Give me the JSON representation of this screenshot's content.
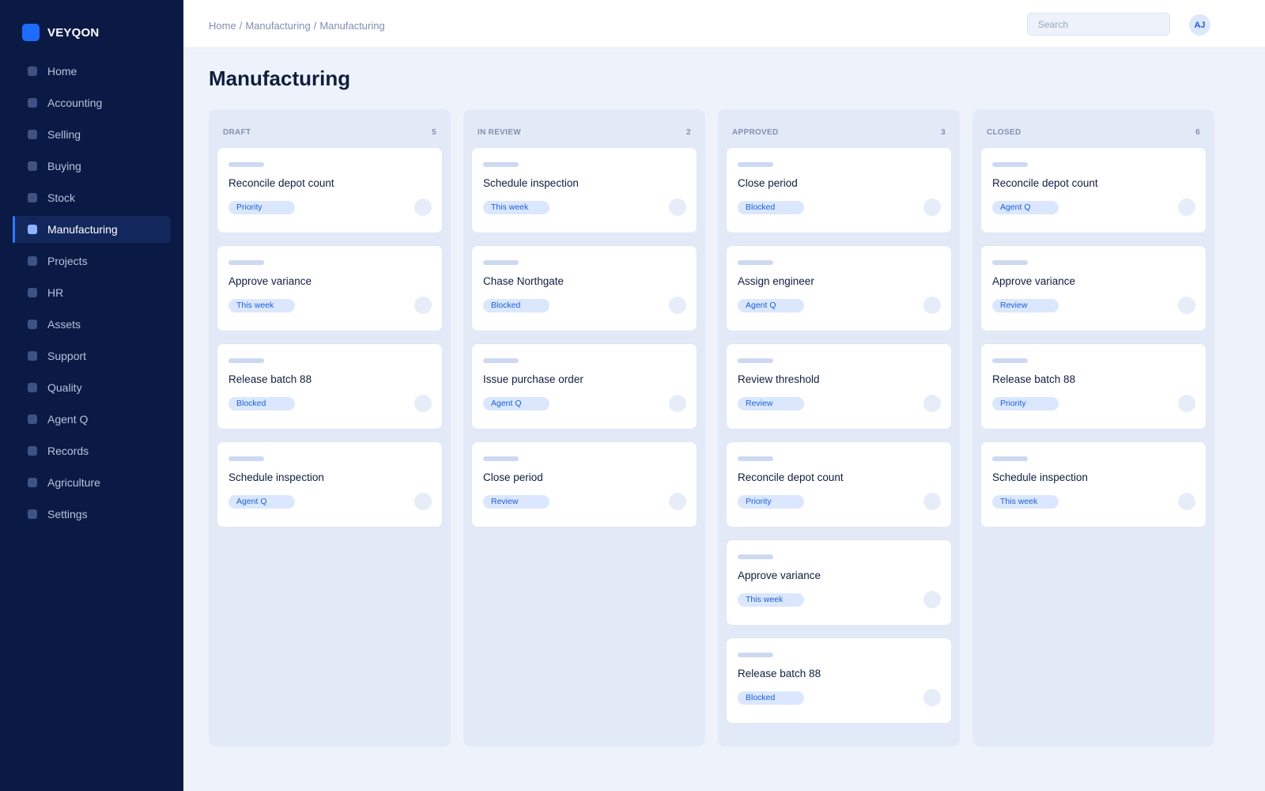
{
  "app": {
    "name": "VEYQON"
  },
  "sidebar": {
    "items": [
      {
        "label": "Home",
        "active": false
      },
      {
        "label": "Accounting",
        "active": false
      },
      {
        "label": "Selling",
        "active": false
      },
      {
        "label": "Buying",
        "active": false
      },
      {
        "label": "Stock",
        "active": false
      },
      {
        "label": "Manufacturing",
        "active": true
      },
      {
        "label": "Projects",
        "active": false
      },
      {
        "label": "HR",
        "active": false
      },
      {
        "label": "Assets",
        "active": false
      },
      {
        "label": "Support",
        "active": false
      },
      {
        "label": "Quality",
        "active": false
      },
      {
        "label": "Agent Q",
        "active": false
      },
      {
        "label": "Records",
        "active": false
      },
      {
        "label": "Agriculture",
        "active": false
      },
      {
        "label": "Settings",
        "active": false
      }
    ]
  },
  "header": {
    "breadcrumb": [
      "Home",
      "Manufacturing",
      "Manufacturing"
    ],
    "search_placeholder": "Search",
    "avatar_initials": "AJ"
  },
  "page": {
    "title": "Manufacturing"
  },
  "board": {
    "columns": [
      {
        "name": "DRAFT",
        "count": "5",
        "cards": [
          {
            "title": "Reconcile depot count",
            "tag": "Priority"
          },
          {
            "title": "Approve variance",
            "tag": "This week"
          },
          {
            "title": "Release batch 88",
            "tag": "Blocked"
          },
          {
            "title": "Schedule inspection",
            "tag": "Agent Q"
          }
        ]
      },
      {
        "name": "IN REVIEW",
        "count": "2",
        "cards": [
          {
            "title": "Schedule inspection",
            "tag": "This week"
          },
          {
            "title": "Chase Northgate",
            "tag": "Blocked"
          },
          {
            "title": "Issue purchase order",
            "tag": "Agent Q"
          },
          {
            "title": "Close period",
            "tag": "Review"
          }
        ]
      },
      {
        "name": "APPROVED",
        "count": "3",
        "cards": [
          {
            "title": "Close period",
            "tag": "Blocked"
          },
          {
            "title": "Assign engineer",
            "tag": "Agent Q"
          },
          {
            "title": "Review threshold",
            "tag": "Review"
          },
          {
            "title": "Reconcile depot count",
            "tag": "Priority"
          },
          {
            "title": "Approve variance",
            "tag": "This week"
          },
          {
            "title": "Release batch 88",
            "tag": "Blocked"
          }
        ]
      },
      {
        "name": "CLOSED",
        "count": "6",
        "cards": [
          {
            "title": "Reconcile depot count",
            "tag": "Agent Q"
          },
          {
            "title": "Approve variance",
            "tag": "Review"
          },
          {
            "title": "Release batch 88",
            "tag": "Priority"
          },
          {
            "title": "Schedule inspection",
            "tag": "This week"
          }
        ]
      }
    ]
  }
}
